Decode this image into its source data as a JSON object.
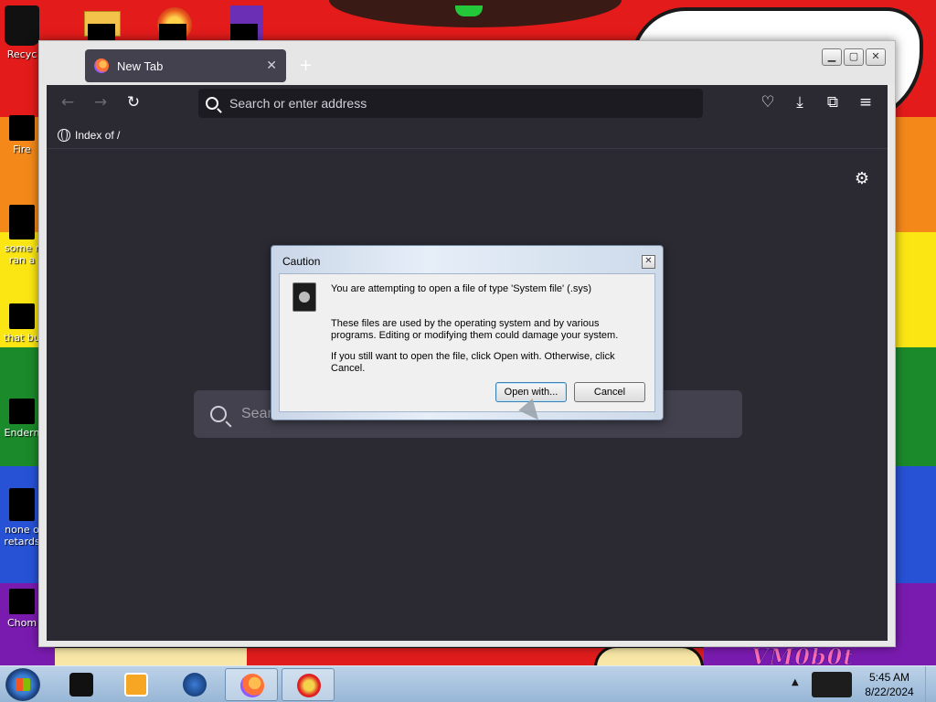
{
  "desktop": {
    "icons": [
      {
        "label": "Recyc"
      },
      {
        "label": "Fire"
      },
      {
        "label": "some r"
      },
      {
        "label": "ran a"
      },
      {
        "label": "that bu"
      },
      {
        "label": "Endern"
      },
      {
        "label": "none o"
      },
      {
        "label": "retards"
      },
      {
        "label": "Chom"
      }
    ]
  },
  "browser": {
    "tab": {
      "title": "New Tab",
      "close_label": "✕"
    },
    "new_tab_label": "+",
    "window_buttons": {
      "minimize": "▁",
      "maximize": "▢",
      "close": "✕"
    },
    "toolbar": {
      "back_icon": "←",
      "forward_icon": "→",
      "reload_icon": "↻",
      "pocket_icon": "♡",
      "download_icon": "⤓",
      "extensions_icon": "⧉",
      "menu_icon": "≡"
    },
    "urlbar": {
      "placeholder": "Search or enter address"
    },
    "bookmark": {
      "label": "Index of /"
    },
    "settings_icon": "⚙",
    "content_search_text": "Searc"
  },
  "dialog": {
    "title": "Caution",
    "close_label": "✕",
    "line1": "You are attempting to open a file of type 'System file' (.sys)",
    "line2": "These files are used by the operating system and by various programs. Editing or modifying them could damage your system.",
    "line3": "If you still want to open the file, click Open with. Otherwise, click Cancel.",
    "open_with_label": "Open with...",
    "cancel_label": "Cancel"
  },
  "taskbar": {
    "time": "5:45 AM",
    "date": "8/22/2024",
    "tray_arrow": "▲"
  },
  "wallpaper": {
    "signature": "VM0b0t"
  }
}
